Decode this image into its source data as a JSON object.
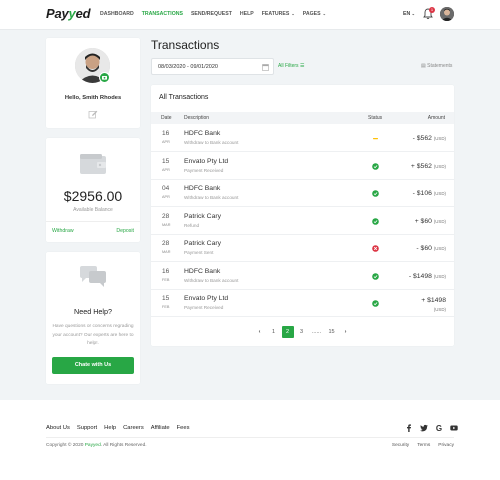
{
  "header": {
    "logo": {
      "prefix": "Pay",
      "accent": "y",
      "suffix": "ed"
    },
    "nav": [
      {
        "label": "DASHBOARD",
        "active": false,
        "caret": false
      },
      {
        "label": "TRANSACTIONS",
        "active": true,
        "caret": false
      },
      {
        "label": "SEND/REQUEST",
        "active": false,
        "caret": false
      },
      {
        "label": "HELP",
        "active": false,
        "caret": false
      },
      {
        "label": "FEATURES",
        "active": false,
        "caret": true
      },
      {
        "label": "PAGES",
        "active": false,
        "caret": true
      }
    ],
    "language": "EN",
    "notification_count": "1"
  },
  "profile": {
    "greeting": "Hello, Smith Rhodes"
  },
  "balance": {
    "amount": "$2956.00",
    "label": "Available Balance",
    "withdraw_label": "Withdraw",
    "deposit_label": "Deposit"
  },
  "help": {
    "title": "Need Help?",
    "text": "Have questions or concerns regrading your account? Our experts are here to help!.",
    "button_label": "Chate with Us"
  },
  "main": {
    "title": "Transactions",
    "date_range": "08/03/2020 - 09/01/2020",
    "filters_label": "All Filters",
    "statements_label": "Statements",
    "card_title": "All Transactions",
    "columns": {
      "date": "Date",
      "description": "Description",
      "status": "Status",
      "amount": "Amount"
    },
    "transactions": [
      {
        "day": "16",
        "month": "APR",
        "name": "HDFC Bank",
        "desc": "Withdraw to Bank account",
        "status": "pending",
        "amount": "- $562",
        "currency": "(USD)"
      },
      {
        "day": "15",
        "month": "APR",
        "name": "Envato Pty Ltd",
        "desc": "Payment Received",
        "status": "success",
        "amount": "+ $562",
        "currency": "(USD)"
      },
      {
        "day": "04",
        "month": "APR",
        "name": "HDFC Bank",
        "desc": "Withdraw to Bank account",
        "status": "success",
        "amount": "- $106",
        "currency": "(USD)"
      },
      {
        "day": "28",
        "month": "MAR",
        "name": "Patrick Cary",
        "desc": "Refund",
        "status": "success",
        "amount": "+ $60",
        "currency": "(USD)"
      },
      {
        "day": "28",
        "month": "MAR",
        "name": "Patrick Cary",
        "desc": "Payment Sent",
        "status": "failed",
        "amount": "- $60",
        "currency": "(USD)"
      },
      {
        "day": "16",
        "month": "FEB",
        "name": "HDFC Bank",
        "desc": "Withdraw to Bank account",
        "status": "success",
        "amount": "- $1498",
        "currency": "(USD)"
      },
      {
        "day": "15",
        "month": "FEB",
        "name": "Envato Pty Ltd",
        "desc": "Payment Received",
        "status": "success",
        "amount": "+ $1498",
        "currency": "(USD)"
      }
    ],
    "pagination": {
      "prev": "‹",
      "pages": [
        "1",
        "2",
        "3"
      ],
      "ellipsis": "......",
      "last": "15",
      "next": "›",
      "current": "2"
    }
  },
  "footer": {
    "links": [
      "About Us",
      "Support",
      "Help",
      "Careers",
      "Affiliate",
      "Fees"
    ],
    "copyright_prefix": "Copyright © 2020 ",
    "copyright_brand": "Payyed",
    "copyright_suffix": ". All Rights Reserved.",
    "legal": [
      "Security",
      "Terms",
      "Privacy"
    ],
    "social": [
      "facebook-icon",
      "twitter-icon",
      "google-icon",
      "youtube-icon"
    ]
  },
  "colors": {
    "accent": "#28a745",
    "danger": "#dc3545",
    "warning": "#ffc107"
  }
}
